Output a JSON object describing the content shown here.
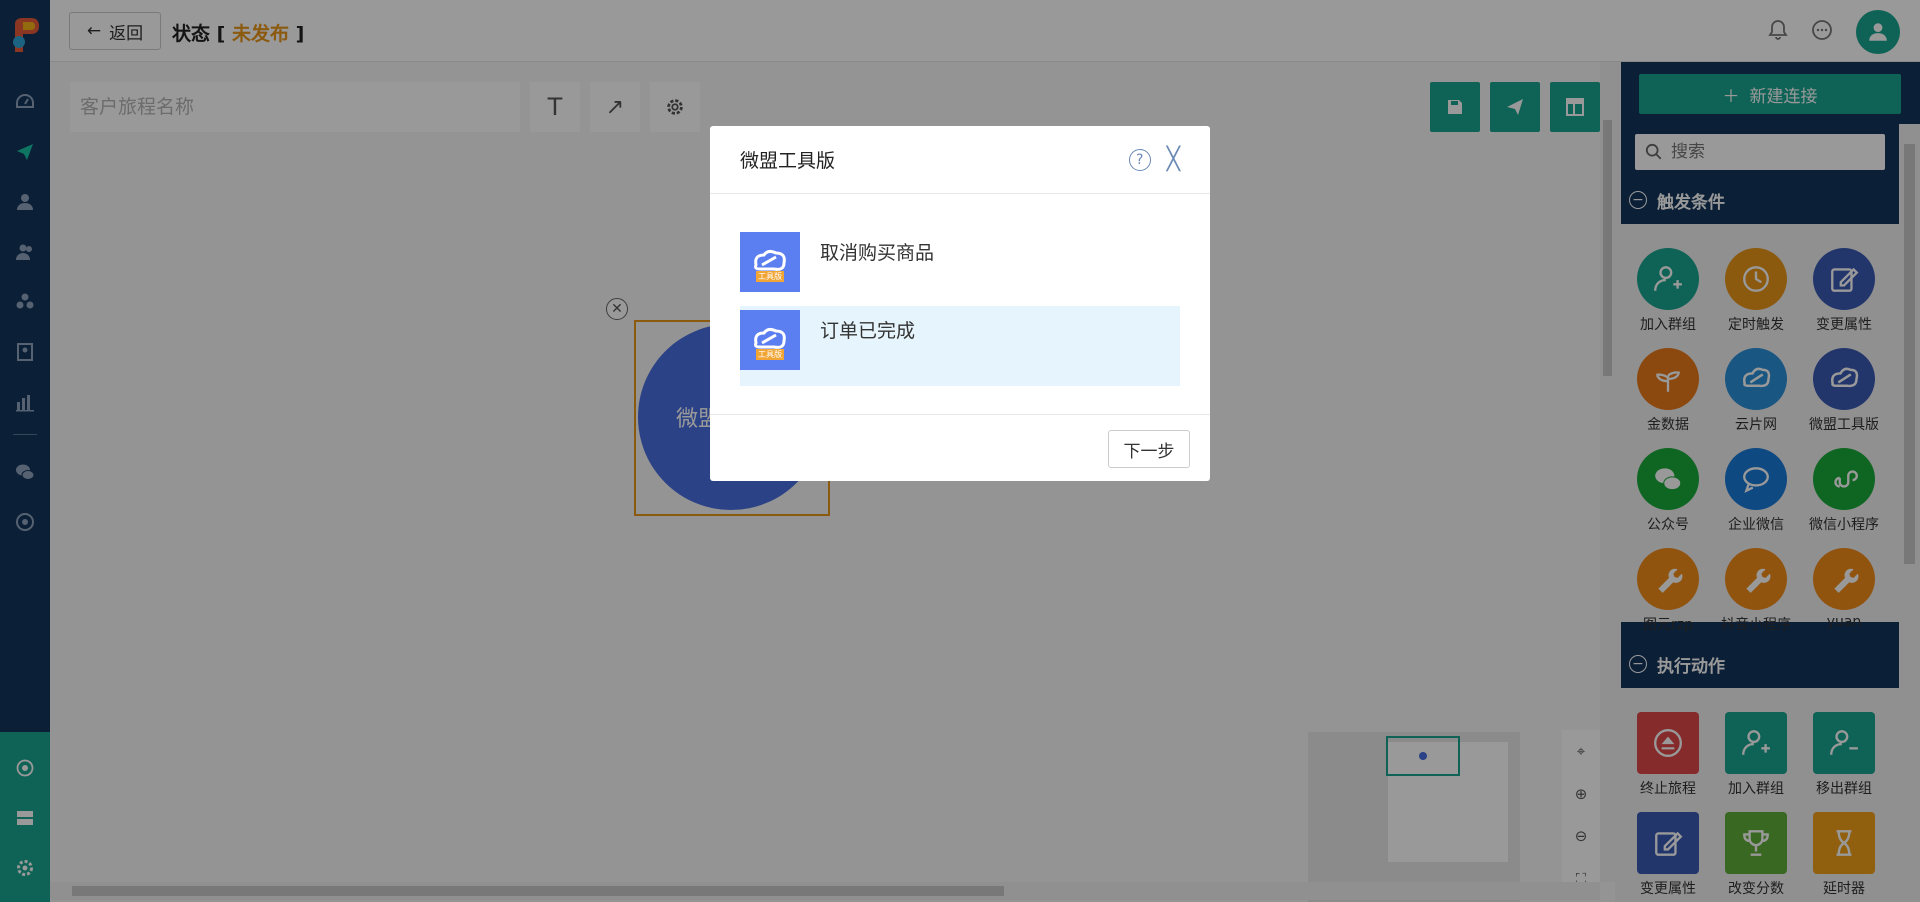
{
  "header": {
    "back_label": "返回",
    "status_label": "状态",
    "status_value": "未发布"
  },
  "canvas": {
    "name_placeholder": "客户旅程名称",
    "node_label": "微盟"
  },
  "right_panel": {
    "new_connection_label": "新建连接",
    "search_placeholder": "搜索",
    "triggers": {
      "title": "触发条件",
      "items": [
        {
          "label": "加入群组",
          "color": "#18a58f",
          "icon": "user-add-icon"
        },
        {
          "label": "定时触发",
          "color": "#e8961a",
          "icon": "clock-icon"
        },
        {
          "label": "变更属性",
          "color": "#3b5bb5",
          "icon": "edit-icon"
        },
        {
          "label": "金数据",
          "color": "#e8791a",
          "icon": "plant-icon"
        },
        {
          "label": "云片网",
          "color": "#2a8fd8",
          "icon": "cloud-icon"
        },
        {
          "label": "微盟工具版",
          "color": "#3b5bb5",
          "icon": "weimob-icon"
        },
        {
          "label": "公众号",
          "color": "#1aab3a",
          "icon": "wechat-icon"
        },
        {
          "label": "企业微信",
          "color": "#1a7ad8",
          "icon": "chat-icon"
        },
        {
          "label": "微信小程序",
          "color": "#1aab3a",
          "icon": "miniprogram-icon"
        },
        {
          "label": "图元rzp",
          "color": "#f08c1a",
          "icon": "wrench-icon"
        },
        {
          "label": "抖音小程序",
          "color": "#f08c1a",
          "icon": "wrench-icon"
        },
        {
          "label": "yuan",
          "color": "#f08c1a",
          "icon": "wrench-icon"
        }
      ]
    },
    "actions": {
      "title": "执行动作",
      "items": [
        {
          "label": "终止旅程",
          "color": "#e04848",
          "icon": "eject-icon"
        },
        {
          "label": "加入群组",
          "color": "#18a58f",
          "icon": "user-add-icon"
        },
        {
          "label": "移出群组",
          "color": "#18a58f",
          "icon": "user-remove-icon"
        },
        {
          "label": "变更属性",
          "color": "#3b5bb5",
          "icon": "edit-icon"
        },
        {
          "label": "改变分数",
          "color": "#5fae3a",
          "icon": "trophy-icon"
        },
        {
          "label": "延时器",
          "color": "#f0a01a",
          "icon": "hourglass-icon"
        }
      ]
    }
  },
  "modal": {
    "title": "微盟工具版",
    "options": [
      {
        "label": "取消购买商品",
        "badge": "工具版"
      },
      {
        "label": "订单已完成",
        "badge": "工具版"
      }
    ],
    "selected_index": 1,
    "next_label": "下一步"
  }
}
